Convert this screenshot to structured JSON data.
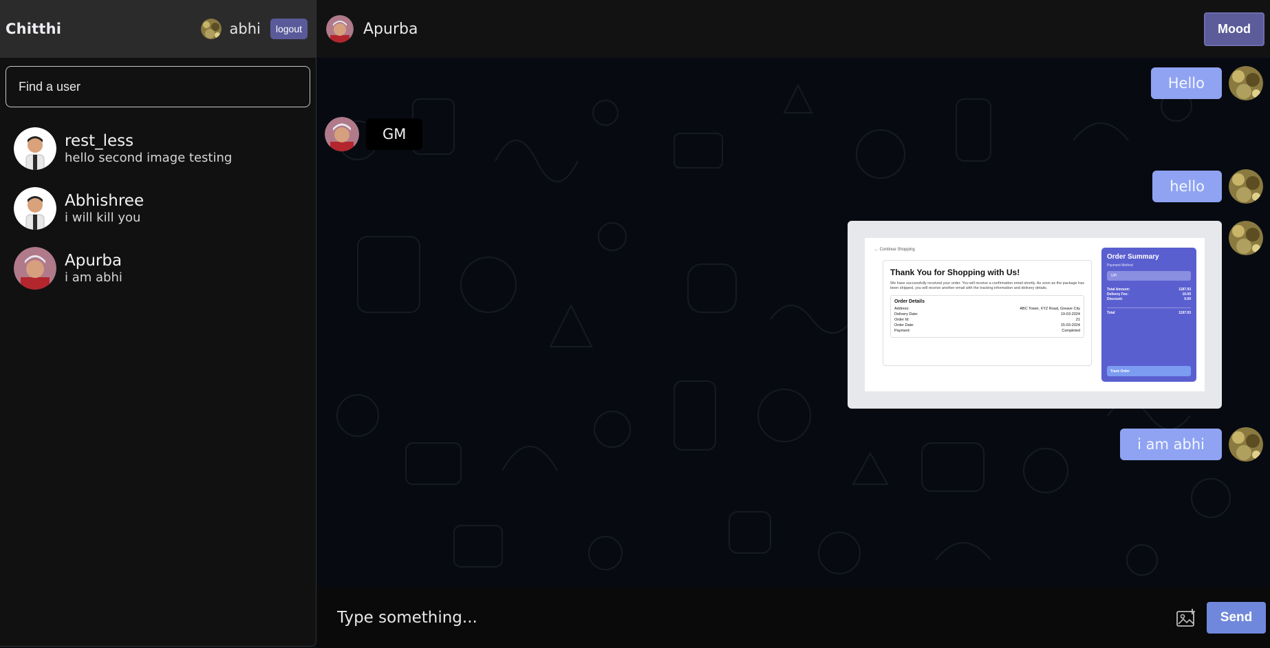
{
  "sidebar": {
    "brand": "Chitthi",
    "current_user": "abhi",
    "logout_label": "logout",
    "search_placeholder": "Find a user",
    "users": [
      {
        "name": "rest_less",
        "last_message": "hello second image testing"
      },
      {
        "name": "Abhishree",
        "last_message": "i will kill you"
      },
      {
        "name": "Apurba",
        "last_message": "i am abhi"
      }
    ]
  },
  "chat": {
    "peer_name": "Apurba",
    "mood_label": "Mood",
    "messages": [
      {
        "direction": "out",
        "text": "Hello"
      },
      {
        "direction": "in",
        "text": "GM"
      },
      {
        "direction": "out",
        "text": "hello"
      },
      {
        "direction": "out",
        "type": "image"
      },
      {
        "direction": "out",
        "text": "i am abhi"
      }
    ],
    "image_preview": {
      "continue_label": "← Continue Shopping",
      "title": "Thank You for Shopping with Us!",
      "body": "We have successfully received your order. You will receive a confirmation email shortly. As soon as the package has been shipped, you will receive another email with the tracking information and delivery details.",
      "order_details_title": "Order Details",
      "order_details": [
        {
          "label": "Address:",
          "value": "ABC Tower, XYZ Road, Greave City"
        },
        {
          "label": "Delivery Date:",
          "value": "19-03-2024"
        },
        {
          "label": "Order Id:",
          "value": "21"
        },
        {
          "label": "Order Date:",
          "value": "15-03-2024"
        },
        {
          "label": "Payment:",
          "value": "Completed"
        }
      ],
      "summary_title": "Order Summary",
      "payment_method_label": "Payment Method",
      "payment_method": "UPI",
      "summary_rows": [
        {
          "label": "Total Amount:",
          "value": "1187.93"
        },
        {
          "label": "Delivery Fee:",
          "value": "10.00"
        },
        {
          "label": "Discount:",
          "value": "0.00"
        }
      ],
      "total_label": "Total",
      "total_value": "1197.93",
      "track_label": "Track Order"
    }
  },
  "composer": {
    "placeholder": "Type something...",
    "send_label": "Send"
  },
  "colors": {
    "accent": "#5c5c9a",
    "outgoing_bubble": "#8fa3f2",
    "send_button": "#7088dc"
  }
}
